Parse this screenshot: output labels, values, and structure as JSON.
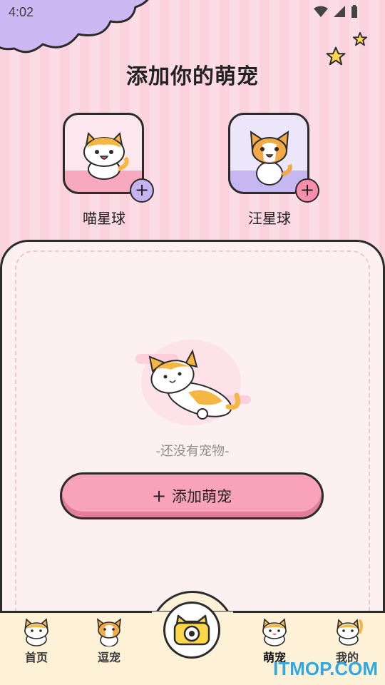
{
  "status_bar": {
    "time": "4:02"
  },
  "page": {
    "title": "添加你的萌宠"
  },
  "pet_types": [
    {
      "label": "喵星球",
      "add": "+"
    },
    {
      "label": "汪星球",
      "add": "+"
    }
  ],
  "empty_state": {
    "text": "-还没有宠物-",
    "button_plus": "+",
    "button_label": "添加萌宠"
  },
  "tab_bar": {
    "tabs": [
      {
        "label": "首页"
      },
      {
        "label": "逗宠"
      },
      {
        "label": "萌宠",
        "active": true
      },
      {
        "label": "我的"
      }
    ]
  },
  "watermark": "ITMOP.COM",
  "colors": {
    "stripe_pink": "#fbd3df",
    "panel": "#fdf0f2",
    "button_pink": "#f9a3bb",
    "tab_bar": "#fdf1d8",
    "badge_purple": "#c5b3f2",
    "badge_pink": "#f78fac"
  }
}
